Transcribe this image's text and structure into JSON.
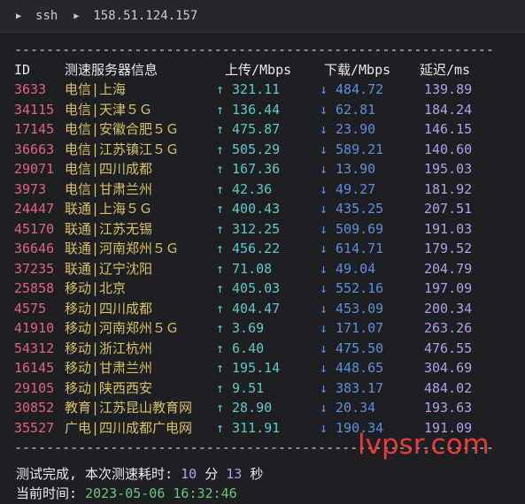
{
  "tabbar": {
    "crumbs": [
      "ssh",
      "158.51.124.157"
    ]
  },
  "separator": "------------------------------------------------------------",
  "headers": {
    "id": "ID",
    "server": "测速服务器信息",
    "upload": "上传/Mbps",
    "download": "下载/Mbps",
    "latency": "延迟/ms"
  },
  "arrows": {
    "up": "↑",
    "down": "↓"
  },
  "rows": [
    {
      "id": "3633",
      "server": "电信|上海",
      "up": "321.11",
      "down": "484.72",
      "ping": "139.89"
    },
    {
      "id": "34115",
      "server": "电信|天津５Ｇ",
      "up": "136.44",
      "down": "62.81",
      "ping": "184.24"
    },
    {
      "id": "17145",
      "server": "电信|安徽合肥５Ｇ",
      "up": "475.87",
      "down": "23.90",
      "ping": "146.15"
    },
    {
      "id": "36663",
      "server": "电信|江苏镇江５Ｇ",
      "up": "505.29",
      "down": "589.21",
      "ping": "140.60"
    },
    {
      "id": "29071",
      "server": "电信|四川成都",
      "up": "167.36",
      "down": "13.90",
      "ping": "195.03"
    },
    {
      "id": "3973",
      "server": "电信|甘肃兰州",
      "up": "42.36",
      "down": "49.27",
      "ping": "181.92"
    },
    {
      "id": "24447",
      "server": "联通|上海５Ｇ",
      "up": "400.43",
      "down": "435.25",
      "ping": "207.51"
    },
    {
      "id": "45170",
      "server": "联通|江苏无锡",
      "up": "312.25",
      "down": "509.69",
      "ping": "191.03"
    },
    {
      "id": "36646",
      "server": "联通|河南郑州５Ｇ",
      "up": "456.22",
      "down": "614.71",
      "ping": "179.52"
    },
    {
      "id": "37235",
      "server": "联通|辽宁沈阳",
      "up": "71.08",
      "down": "49.04",
      "ping": "204.79"
    },
    {
      "id": "25858",
      "server": "移动|北京",
      "up": "405.03",
      "down": "552.16",
      "ping": "197.09"
    },
    {
      "id": "4575",
      "server": "移动|四川成都",
      "up": "404.47",
      "down": "453.09",
      "ping": "200.34"
    },
    {
      "id": "41910",
      "server": "移动|河南郑州５Ｇ",
      "up": "3.69",
      "down": "171.07",
      "ping": "263.26"
    },
    {
      "id": "54312",
      "server": "移动|浙江杭州",
      "up": "6.40",
      "down": "475.50",
      "ping": "476.55"
    },
    {
      "id": "16145",
      "server": "移动|甘肃兰州",
      "up": "195.14",
      "down": "448.65",
      "ping": "304.69"
    },
    {
      "id": "29105",
      "server": "移动|陕西西安",
      "up": "9.51",
      "down": "383.17",
      "ping": "484.02"
    },
    {
      "id": "30852",
      "server": "教育|江苏昆山教育网",
      "up": "28.90",
      "down": "20.34",
      "ping": "193.63"
    },
    {
      "id": "35527",
      "server": "广电|四川成都广电网",
      "up": "311.91",
      "down": "190.34",
      "ping": "191.09"
    }
  ],
  "summary": {
    "done_prefix": "测试完成, 本次测速耗时: ",
    "minutes": "10",
    "minutes_unit": " 分 ",
    "seconds": "13",
    "seconds_unit": " 秒",
    "time_prefix": "当前时间: ",
    "time_value": "2023-05-06 16:32:46"
  },
  "watermark": "lvpsr.com",
  "colors": {
    "background": "#1e1f22",
    "id": "#e0607e",
    "server": "#d8c060",
    "upload": "#5fc7c8",
    "download": "#5b8fd8",
    "latency": "#b89ae8",
    "time": "#6cc47a",
    "watermark": "#ff3b3b"
  }
}
